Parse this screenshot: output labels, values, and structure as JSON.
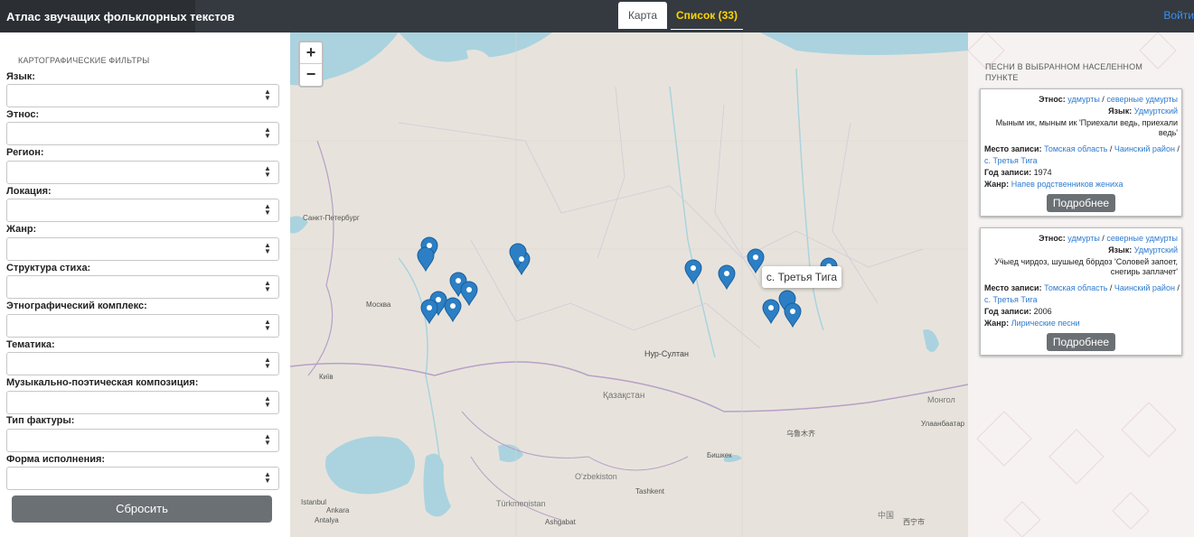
{
  "header": {
    "app_title": "Атлас звучащих фольклорных текстов",
    "tabs": [
      {
        "label": "Карта"
      },
      {
        "label": "Список (33)"
      }
    ],
    "login_label": "Войти"
  },
  "filters": {
    "heading": "КАРТОГРАФИЧЕСКИЕ ФИЛЬТРЫ",
    "items": [
      {
        "label": "Язык:",
        "value": ""
      },
      {
        "label": "Этнос:",
        "value": ""
      },
      {
        "label": "Регион:",
        "value": ""
      },
      {
        "label": "Локация:",
        "value": ""
      },
      {
        "label": "Жанр:",
        "value": ""
      },
      {
        "label": "Структура стиха:",
        "value": ""
      },
      {
        "label": "Этнографический комплекс:",
        "value": ""
      },
      {
        "label": "Тематика:",
        "value": ""
      },
      {
        "label": "Музыкально-поэтическая композиция:",
        "value": ""
      },
      {
        "label": "Тип фактуры:",
        "value": ""
      },
      {
        "label": "Форма исполнения:",
        "value": ""
      }
    ],
    "reset_label": "Сбросить"
  },
  "map": {
    "zoom_in": "+",
    "zoom_out": "−",
    "tooltip": "с. Третья Тига",
    "place_labels": [
      "Санкт-Петербург",
      "Москва",
      "Київ",
      "Нур-Султан",
      "Қазақстан",
      "Бишкек",
      "Tashkent",
      "Türkmenistan",
      "O'zbekiston",
      "Монгол",
      "Улаанбаатар",
      "Istanbul",
      "Ankara",
      "Antalya",
      "Ashgabat",
      "乌鲁木齐",
      "中国",
      "西宁市"
    ],
    "marker_color": "#2c7fc4"
  },
  "songs": {
    "heading": "ПЕСНИ В ВЫБРАННОМ НАСЕЛЕННОМ ПУНКТЕ",
    "labels": {
      "ethnos": "Этнос:",
      "language": "Язык:",
      "place": "Место записи:",
      "year": "Год записи:",
      "genre": "Жанр:"
    },
    "items": [
      {
        "ethnos": [
          "удмурты",
          "северные удмурты"
        ],
        "language": "Удмуртский",
        "title": "Мыным ик, мыным ик 'Приехали ведь, приехали ведь'",
        "place": [
          "Томская область",
          "Чаинский район",
          "с. Третья Тига"
        ],
        "year": "1974",
        "genre": "Напев родственников жениха",
        "button": "Подробнее"
      },
      {
        "ethnos": [
          "удмурты",
          "северные удмурты"
        ],
        "language": "Удмуртский",
        "title": "Уӵыед чирдоз, шушыед бöрдоз 'Соловей запоет, снегирь заплачет'",
        "place": [
          "Томская область",
          "Чаинский район",
          "с. Третья Тига"
        ],
        "year": "2006",
        "genre": "Лирические песни",
        "button": "Подробнее"
      }
    ]
  }
}
